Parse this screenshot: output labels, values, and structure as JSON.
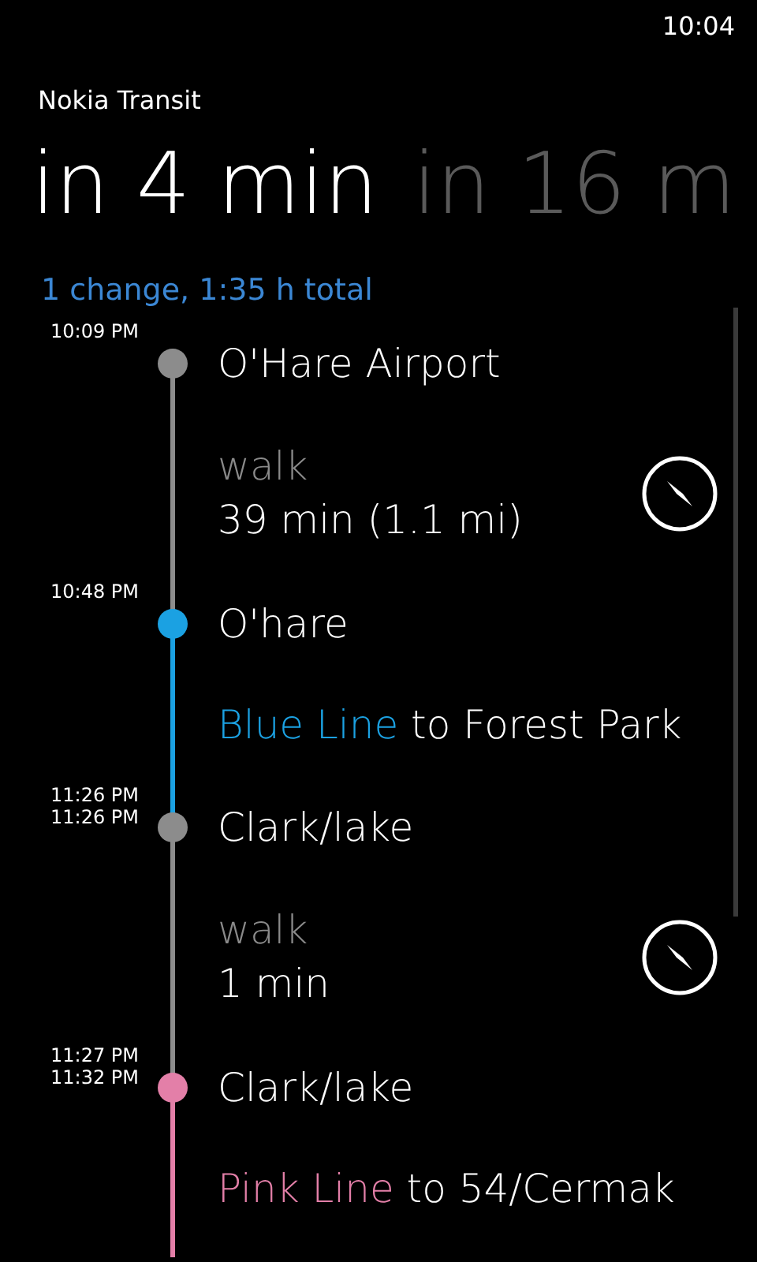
{
  "status_bar": {
    "time": "10:04"
  },
  "app_title": "Nokia Transit",
  "pivot": [
    {
      "label": "in 4 min",
      "selected": true
    },
    {
      "label": "in 16 m",
      "selected": false
    }
  ],
  "summary": "1 change, 1:35 h total",
  "steps": [
    {
      "kind": "stop",
      "times": [
        "10:09 PM"
      ],
      "name": "O'Hare Airport",
      "color": "#8c8c8c"
    },
    {
      "kind": "walk",
      "label": "walk",
      "detail": "39 min (1.1 mi)",
      "color": "#8c8c8c"
    },
    {
      "kind": "stop",
      "times": [
        "10:48 PM"
      ],
      "name": "O'hare",
      "color": "#1ba1e2"
    },
    {
      "kind": "transit",
      "line": "Blue Line",
      "destination": "to Forest Park",
      "color": "#1ba1e2"
    },
    {
      "kind": "stop",
      "times": [
        "11:26 PM",
        "11:26 PM"
      ],
      "name": "Clark/lake",
      "color": "#8c8c8c"
    },
    {
      "kind": "walk",
      "label": "walk",
      "detail": "1 min",
      "color": "#8c8c8c"
    },
    {
      "kind": "stop",
      "times": [
        "11:27 PM",
        "11:32 PM"
      ],
      "name": "Clark/lake",
      "color": "#e37fa8"
    },
    {
      "kind": "transit",
      "line": "Pink Line",
      "destination": "to 54/Cermak",
      "color": "#e37fa8"
    }
  ]
}
